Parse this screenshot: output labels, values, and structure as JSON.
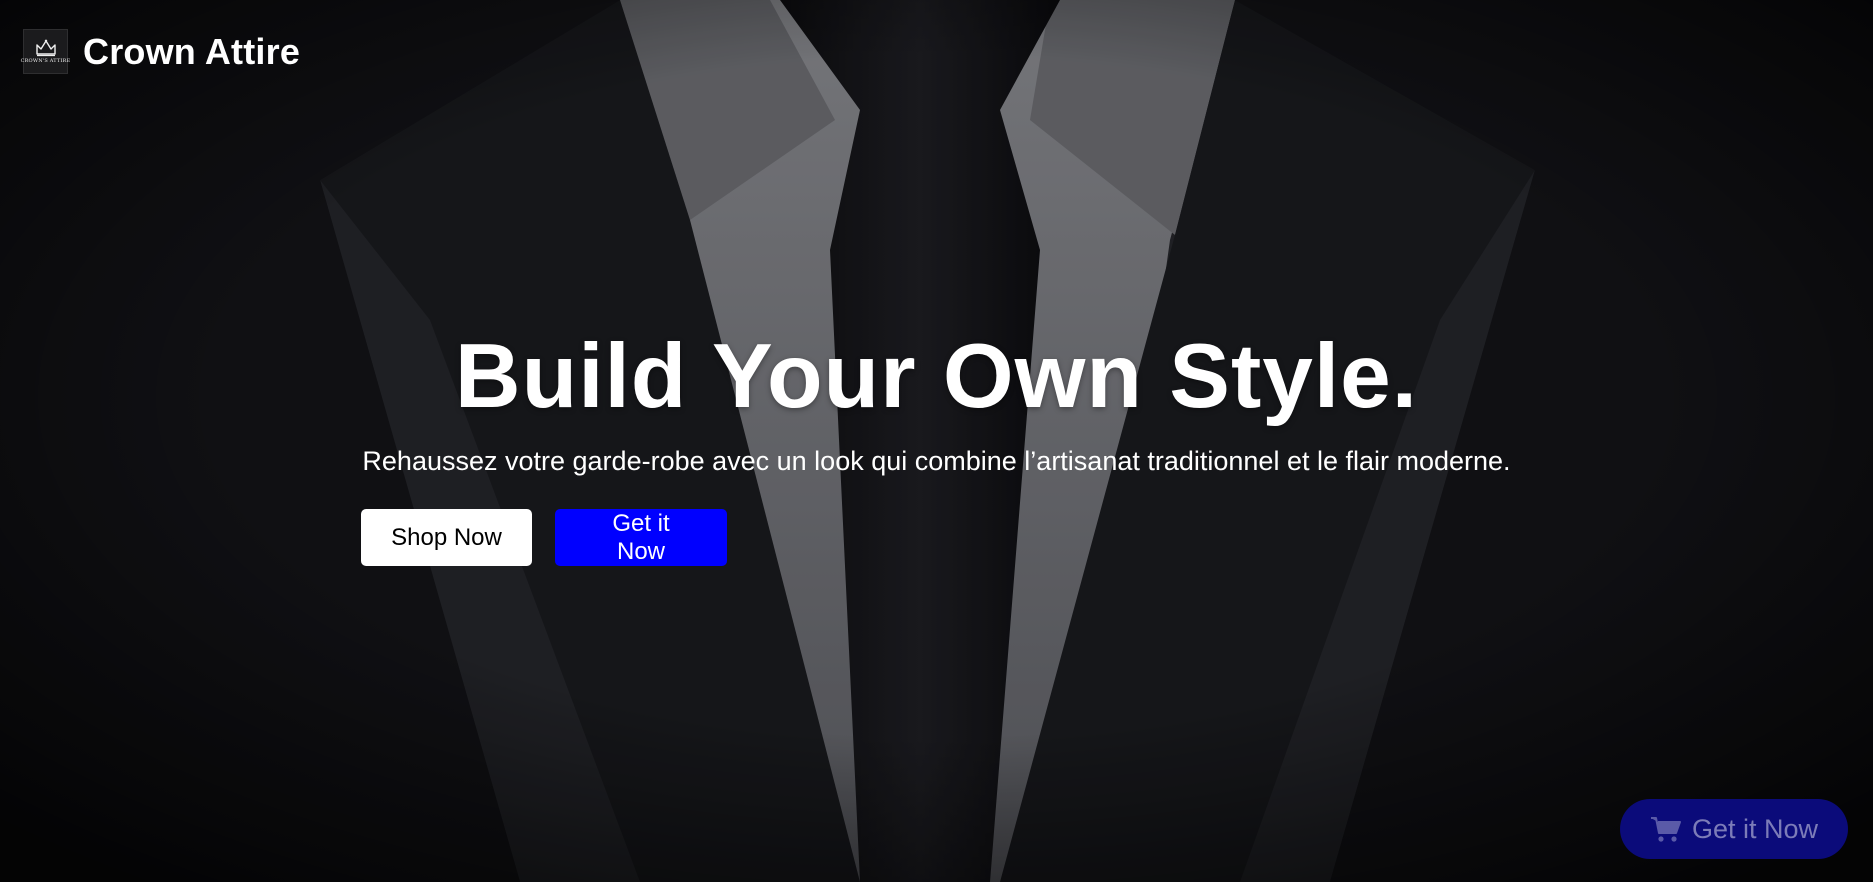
{
  "brand": {
    "logo_text": "CROWN'S ATTIRE",
    "name": "Crown Attire"
  },
  "hero": {
    "title": "Build Your Own Style.",
    "subtitle": "Rehaussez votre garde-robe avec un look qui combine l’artisanat traditionnel et le flair moderne.",
    "background_image": "suit-and-tie-closeup",
    "buttons": {
      "shop_now": "Shop Now",
      "get_it_now": "Get it Now"
    }
  },
  "floating_action": {
    "icon": "shopping-cart-icon",
    "label": "Get it Now"
  },
  "colors": {
    "primary_blue": "#0000ff",
    "fab_blue": "#0b0b7a",
    "text_white": "#ffffff"
  }
}
